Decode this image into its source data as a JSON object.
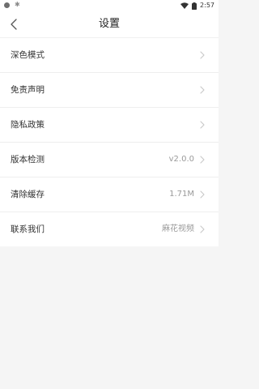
{
  "status_bar": {
    "time": "2:57"
  },
  "header": {
    "title": "设置"
  },
  "settings": [
    {
      "label": "深色模式",
      "value": ""
    },
    {
      "label": "免责声明",
      "value": ""
    },
    {
      "label": "隐私政策",
      "value": ""
    },
    {
      "label": "版本检测",
      "value": "v2.0.0"
    },
    {
      "label": "清除缓存",
      "value": "1.71M"
    },
    {
      "label": "联系我们",
      "value": "麻花视频"
    }
  ],
  "colors": {
    "background": "#f5f5f5",
    "surface": "#ffffff",
    "text_primary": "#333333",
    "text_secondary": "#9a9a9a",
    "divider": "#eeeeee"
  },
  "icons": {
    "back": "chevron-left-icon",
    "row_arrow": "chevron-right-icon",
    "wifi": "wifi-icon",
    "battery": "battery-icon"
  }
}
